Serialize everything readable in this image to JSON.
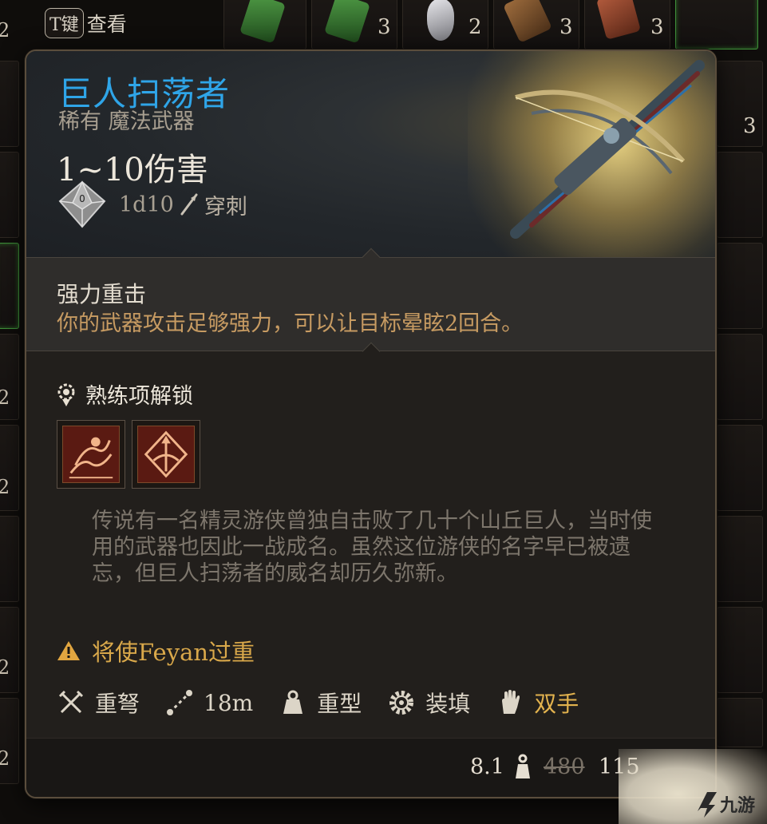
{
  "hotkey": {
    "key": "T键",
    "label": "查看"
  },
  "inventory": {
    "top_counts": [
      "3",
      "2",
      "3",
      "3"
    ],
    "side_count": "3",
    "edge_numbers": [
      "2",
      "2",
      "2",
      "2",
      "2"
    ]
  },
  "item": {
    "name": "巨人扫荡者",
    "rarity": "稀有 魔法武器",
    "damage": "1~10伤害",
    "dice": "1d10",
    "damage_type": "穿刺"
  },
  "passive": {
    "title": "强力重击",
    "description": "你的武器攻击足够强力，可以让目标晕眩2回合。"
  },
  "proficiency": {
    "title": "熟练项解锁"
  },
  "lore": "传说有一名精灵游侠曾独自击败了几十个山丘巨人，当时使用的武器也因此一战成名。虽然这位游侠的名字早已被遗忘，但巨人扫荡者的威名却历久弥新。",
  "warning": "将使Feyan过重",
  "properties": [
    {
      "icon": "crossed-swords-icon",
      "label": "重弩"
    },
    {
      "icon": "range-icon",
      "label": "18m"
    },
    {
      "icon": "heavy-weight-icon",
      "label": "重型"
    },
    {
      "icon": "gear-icon",
      "label": "装填"
    },
    {
      "icon": "hand-icon",
      "label": "双手"
    }
  ],
  "footer": {
    "weight": "8.1",
    "old_price": "480",
    "new_price": "115"
  },
  "colors": {
    "name": "#2fa5e8",
    "passive_desc": "#c79b62",
    "warning": "#d9a84a",
    "lore": "#7d766c"
  }
}
